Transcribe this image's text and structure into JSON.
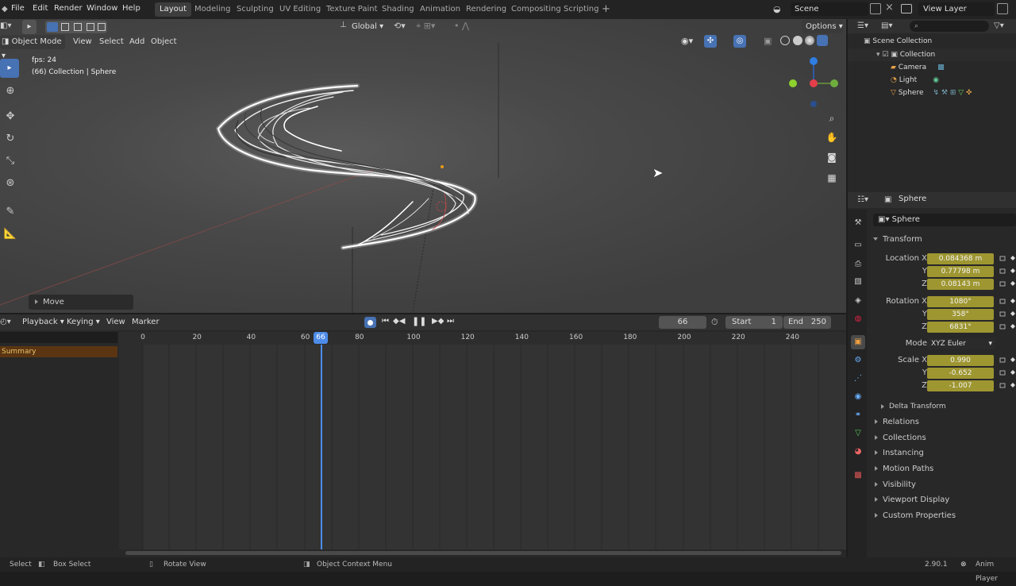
{
  "app_menu": [
    "File",
    "Edit",
    "Render",
    "Window",
    "Help"
  ],
  "workspaces": [
    "Layout",
    "Modeling",
    "Sculpting",
    "UV Editing",
    "Texture Paint",
    "Shading",
    "Animation",
    "Rendering",
    "Compositing",
    "Scripting"
  ],
  "active_workspace": "Layout",
  "scene": {
    "name": "Scene",
    "view_layer": "View Layer"
  },
  "viewport": {
    "mode": "Object Mode",
    "menus": [
      "View",
      "Select",
      "Add",
      "Object"
    ],
    "orientation": "Global",
    "options_label": "Options",
    "overlay_fps": "fps: 24",
    "overlay_collection": "(66) Collection | Sphere",
    "last_op": "Move"
  },
  "timeline": {
    "menus": [
      "Playback",
      "Keying",
      "View",
      "Marker"
    ],
    "current_frame": "66",
    "start_label": "Start",
    "start": "1",
    "end_label": "End",
    "end": "250",
    "summary": "Summary",
    "ruler": [
      "0",
      "20",
      "40",
      "60",
      "66",
      "80",
      "100",
      "120",
      "140",
      "160",
      "180",
      "200",
      "220",
      "240"
    ]
  },
  "outliner": {
    "root": "Scene Collection",
    "collection": "Collection",
    "items": [
      "Camera",
      "Light",
      "Sphere"
    ]
  },
  "properties": {
    "header_object": "Sphere",
    "object_name": "Sphere",
    "transform_label": "Transform",
    "location": {
      "label": "Location X",
      "x": "0.084368 m",
      "y": "0.77798 m",
      "z": "0.08143 m"
    },
    "rotation": {
      "label": "Rotation X",
      "x": "1080°",
      "y": "358°",
      "z": "6831°"
    },
    "mode_label": "Mode",
    "mode_value": "XYZ Euler",
    "scale": {
      "label": "Scale X",
      "x": "0.990",
      "y": "-0.652",
      "z": "-1.007"
    },
    "axis_y": "Y",
    "axis_z": "Z",
    "delta": "Delta Transform",
    "panels": [
      "Relations",
      "Collections",
      "Instancing",
      "Motion Paths",
      "Visibility",
      "Viewport Display",
      "Custom Properties"
    ]
  },
  "status": {
    "select": "Select",
    "box_select": "Box Select",
    "rotate": "Rotate View",
    "context": "Object Context Menu",
    "version": "2.90.1",
    "app": "Anim Player"
  },
  "colors": {
    "accent": "#4772b3",
    "field": "#9e9631",
    "playhead": "#4d8ce9",
    "summary": "#5b3512"
  }
}
